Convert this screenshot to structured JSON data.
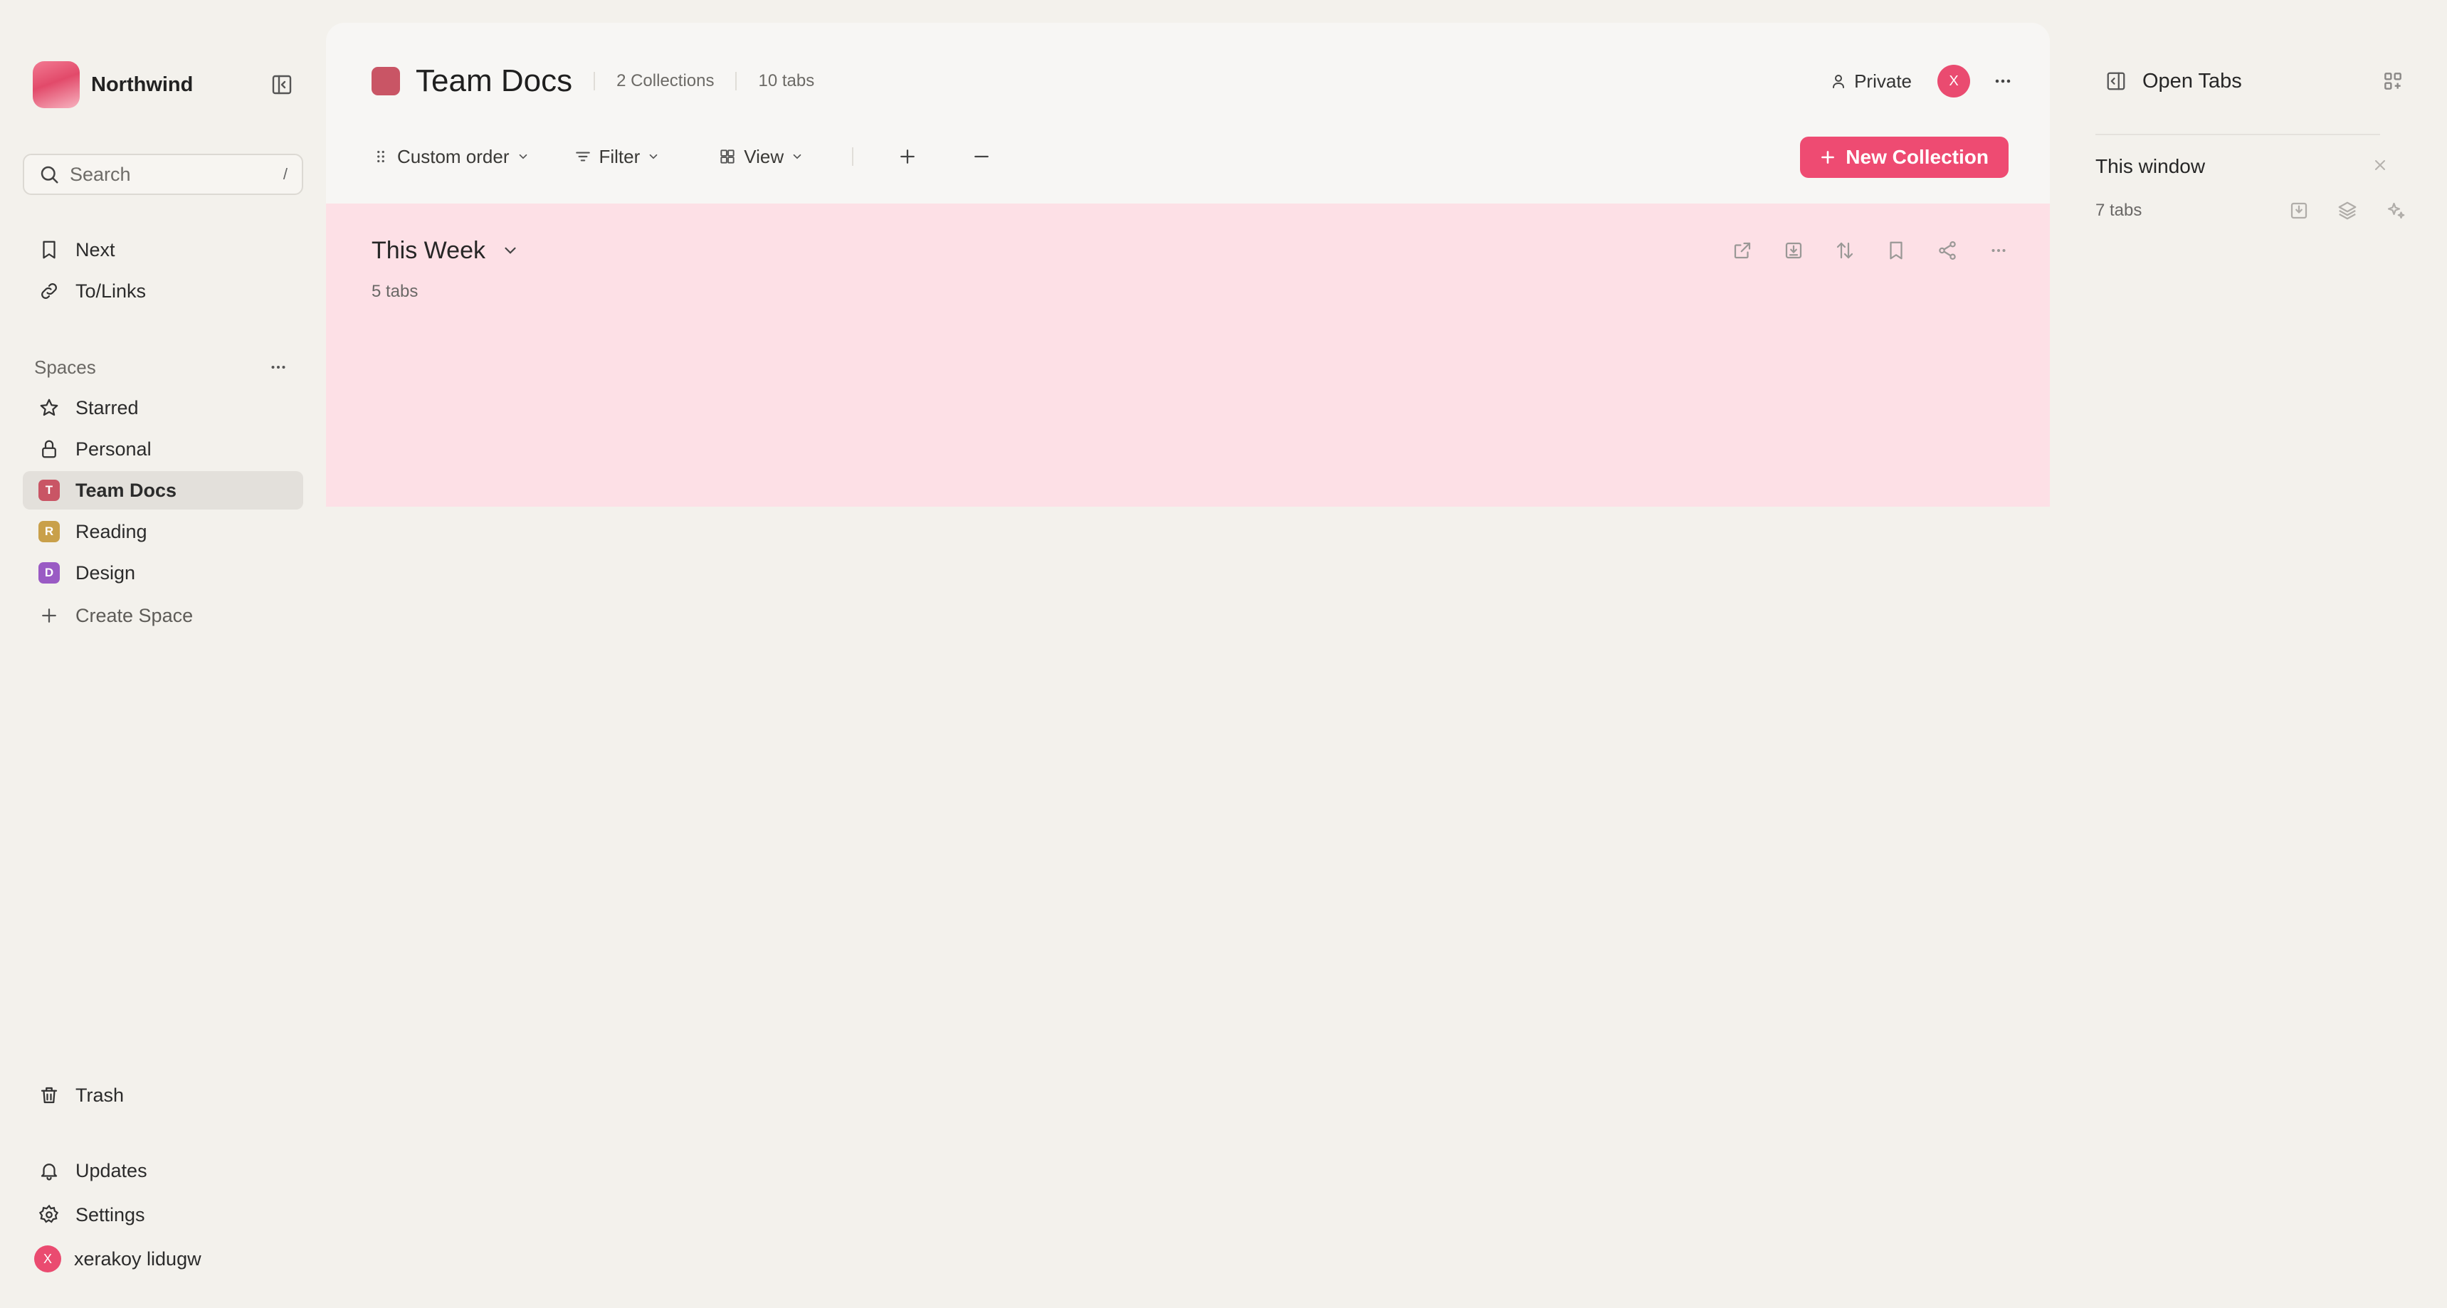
{
  "colors": {
    "accent": "#ee4b72",
    "team_docs": "#c95565",
    "reading": "#c9a04a",
    "design": "#9a5bc4",
    "collection_bg": "#fde0e6"
  },
  "sidebar": {
    "brand_name": "Northwind",
    "search": {
      "placeholder": "Search",
      "shortcut": "/"
    },
    "top_items": [
      {
        "label": "Next",
        "icon": "bookmark-icon"
      },
      {
        "label": "To/Links",
        "icon": "link-icon"
      }
    ],
    "spaces_heading": "Spaces",
    "spaces": [
      {
        "label": "Starred",
        "icon": "star-icon"
      },
      {
        "label": "Personal",
        "icon": "lock-icon"
      },
      {
        "label": "Team Docs",
        "letter": "T",
        "active": true
      },
      {
        "label": "Reading",
        "letter": "R"
      },
      {
        "label": "Design",
        "letter": "D"
      }
    ],
    "create_space": "Create Space",
    "trash": "Trash",
    "updates": "Updates",
    "settings": "Settings",
    "user": {
      "initial": "X",
      "name": "xerakoy lidugw"
    }
  },
  "header": {
    "title": "Team Docs",
    "collections_count": "2 Collections",
    "tabs_count": "10 tabs",
    "privacy": "Private",
    "avatar_initial": "X"
  },
  "toolbar": {
    "sort": "Custom order",
    "filter": "Filter",
    "view": "View",
    "new_collection": "New Collection"
  },
  "collection": {
    "title": "This Week",
    "count": "5 tabs"
  },
  "right_panel": {
    "title": "Open Tabs",
    "window_title": "This window",
    "window_count": "7 tabs"
  }
}
